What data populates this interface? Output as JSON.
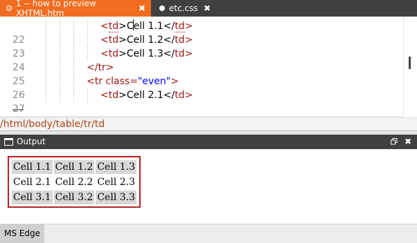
{
  "tabs": [
    {
      "label": "1 -- how to preview XHTML.htm",
      "close": "✖",
      "active": true
    },
    {
      "label": "etc.css",
      "close": "✖",
      "active": false
    }
  ],
  "editor": {
    "lines": [
      {
        "num": "22",
        "pre": "<",
        "tag": "td",
        "mid": ">C",
        "mid2": "ell 1.1</",
        "tag2": "td",
        "end": ">"
      },
      {
        "num": "23",
        "open": "<",
        "tag": "td",
        "text": ">Cell 1.2</",
        "tag2": "td",
        "close": ">"
      },
      {
        "num": "24",
        "open": "<",
        "tag": "td",
        "text": ">Cell 1.3</",
        "tag2": "td",
        "close": ">"
      },
      {
        "num": "25",
        "code": "</tr>"
      },
      {
        "num": "26",
        "open": "<tr ",
        "attr": "class=",
        "val": "\"even\"",
        "close": ">"
      },
      {
        "num": "27",
        "open": "<",
        "tag": "td",
        "text": ">Cell 2.1</",
        "tag2": "td",
        "close": ">"
      }
    ]
  },
  "path": "/html/body/table/tr/td",
  "output": {
    "title": "Output",
    "close": "✖",
    "table": [
      [
        "Cell 1.1",
        "Cell 1.2",
        "Cell 1.3"
      ],
      [
        "Cell 2.1",
        "Cell 2.2",
        "Cell 2.3"
      ],
      [
        "Cell 3.1",
        "Cell 3.2",
        "Cell 3.3"
      ]
    ]
  },
  "status": {
    "browser": "MS Edge"
  },
  "colors": {
    "accent": "#f26d21",
    "tag": "#a31515",
    "attr_value": "#0000ff",
    "path": "#a8461a",
    "table_border": "#b22222"
  }
}
